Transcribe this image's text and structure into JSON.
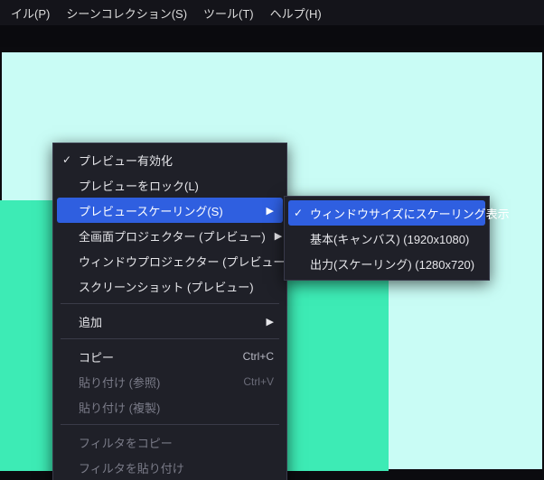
{
  "menubar": {
    "items": [
      {
        "label": "イル(P)"
      },
      {
        "label": "シーンコレクション(S)"
      },
      {
        "label": "ツール(T)"
      },
      {
        "label": "ヘルプ(H)"
      }
    ]
  },
  "colors": {
    "canvas_bg": "#c9fcf5",
    "canvas_shape": "#3debb5",
    "highlight": "#2f5fe0"
  },
  "context_menu": {
    "items": [
      {
        "label": "プレビュー有効化",
        "checked": true
      },
      {
        "label": "プレビューをロック(L)"
      },
      {
        "label": "プレビュースケーリング(S)",
        "submenu": true,
        "highlighted": true
      },
      {
        "label": "全画面プロジェクター (プレビュー)",
        "submenu": true
      },
      {
        "label": "ウィンドウプロジェクター (プレビュー)"
      },
      {
        "label": "スクリーンショット (プレビュー)"
      },
      {
        "separator": true
      },
      {
        "label": "追加",
        "submenu": true
      },
      {
        "separator": true
      },
      {
        "label": "コピー",
        "shortcut": "Ctrl+C"
      },
      {
        "label": "貼り付け (参照)",
        "shortcut": "Ctrl+V",
        "disabled": true
      },
      {
        "label": "貼り付け (複製)",
        "disabled": true
      },
      {
        "separator": true
      },
      {
        "label": "フィルタをコピー",
        "disabled": true
      },
      {
        "label": "フィルタを貼り付け",
        "disabled": true
      }
    ]
  },
  "submenu": {
    "items": [
      {
        "label": "ウィンドウサイズにスケーリング表示",
        "checked": true,
        "highlighted": true
      },
      {
        "label": "基本(キャンバス) (1920x1080)"
      },
      {
        "label": "出力(スケーリング) (1280x720)"
      }
    ]
  }
}
